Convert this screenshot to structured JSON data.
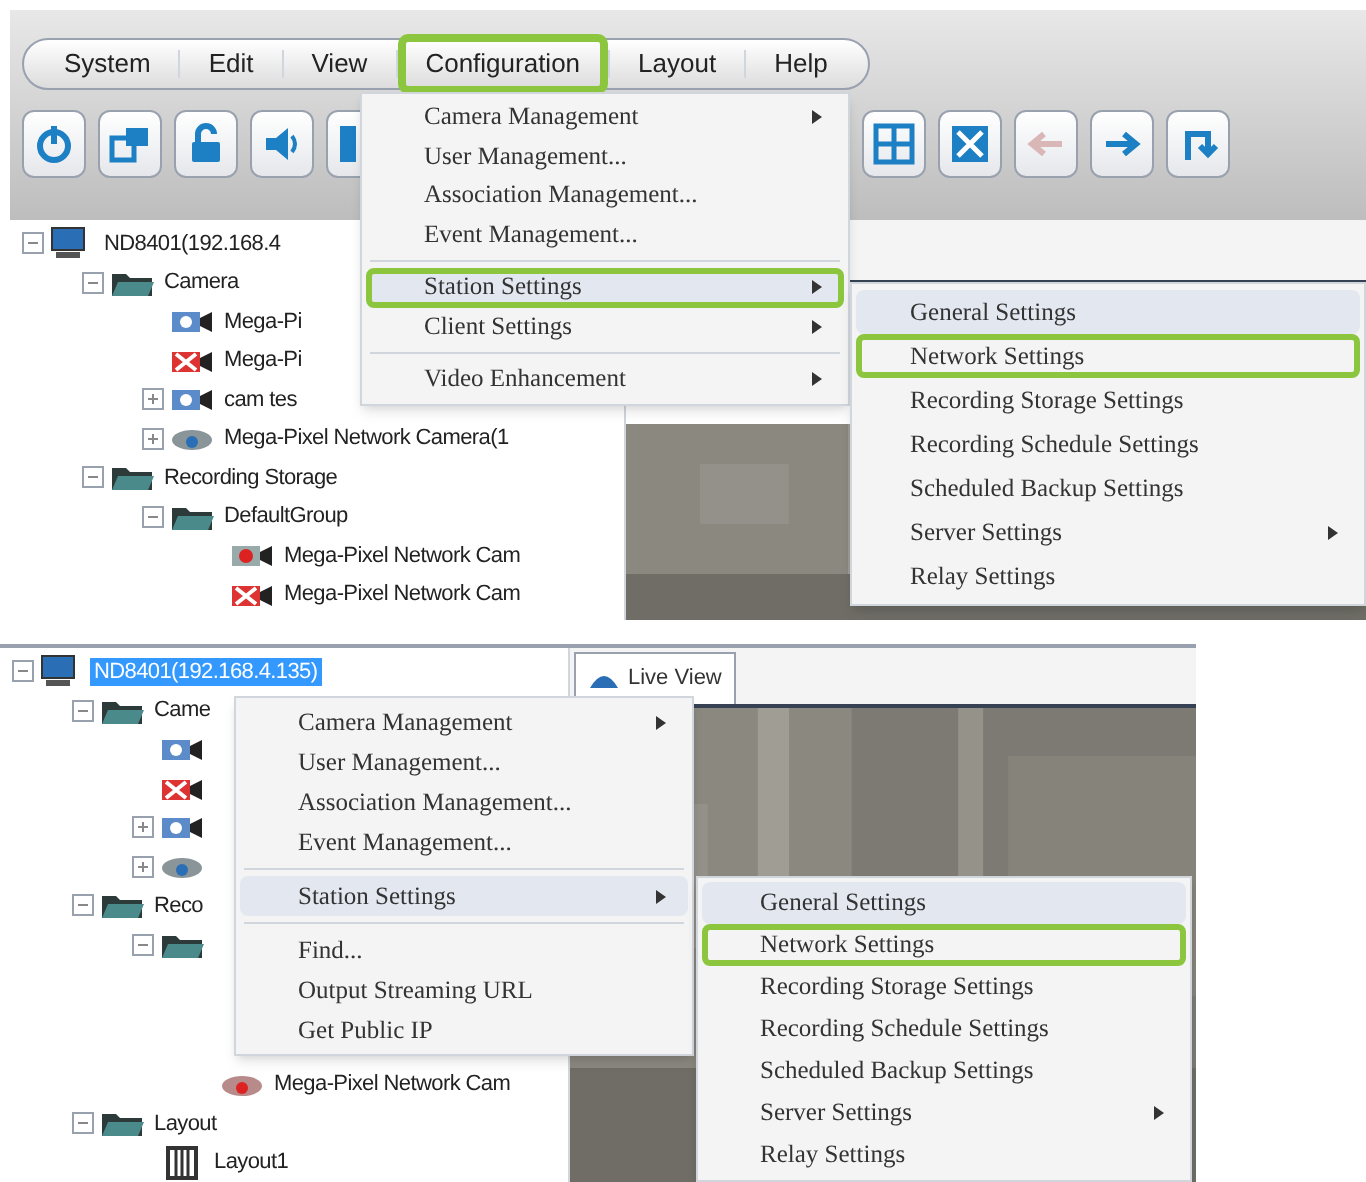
{
  "panels": [
    {
      "menubar": [
        {
          "label": "System",
          "callout": false
        },
        {
          "label": "Edit",
          "callout": false
        },
        {
          "label": "View",
          "callout": false
        },
        {
          "label": "Configuration",
          "callout": true
        },
        {
          "label": "Layout",
          "callout": false
        },
        {
          "label": "Help",
          "callout": false
        }
      ],
      "toolbar_left": [
        {
          "kind": "power"
        },
        {
          "kind": "windows"
        },
        {
          "kind": "lock"
        },
        {
          "kind": "speaker"
        },
        {
          "kind": "partial"
        }
      ],
      "toolbar_right": [
        {
          "kind": "grid"
        },
        {
          "kind": "fullscreen"
        },
        {
          "kind": "back",
          "disabled": true
        },
        {
          "kind": "forward",
          "disabled": false
        },
        {
          "kind": "return"
        }
      ],
      "tree": [
        {
          "label": "ND8401(192.168.4",
          "kind": "computer",
          "selected": false,
          "expanded": true,
          "children": [
            {
              "label": "Camera",
              "kind": "folder",
              "selected": false,
              "expanded": true,
              "children": [
                {
                  "label": "Mega-Pi",
                  "kind": "camera",
                  "selected": false
                },
                {
                  "label": "Mega-Pi",
                  "kind": "camera-off",
                  "selected": false
                },
                {
                  "label": "cam tes",
                  "kind": "camera",
                  "selected": false,
                  "expanded": false
                },
                {
                  "label": "Mega-Pixel Network Camera(1",
                  "kind": "dome",
                  "selected": false,
                  "expanded": false
                }
              ]
            },
            {
              "label": "Recording Storage",
              "kind": "folder",
              "selected": false,
              "expanded": true,
              "children": [
                {
                  "label": "DefaultGroup",
                  "kind": "folder",
                  "selected": false,
                  "expanded": true,
                  "children": [
                    {
                      "label": "Mega-Pixel Network Cam",
                      "kind": "camera-rec",
                      "selected": false
                    },
                    {
                      "label": "Mega-Pixel Network Cam",
                      "kind": "camera-off",
                      "selected": false
                    }
                  ]
                }
              ]
            }
          ]
        }
      ],
      "menu": [
        {
          "kind": "item",
          "label": "Camera Management",
          "submenu": true,
          "highlighted": false,
          "callout": false
        },
        {
          "kind": "item",
          "label": "User Management...",
          "submenu": false,
          "highlighted": false,
          "callout": false
        },
        {
          "kind": "item",
          "label": "Association Management...",
          "submenu": false,
          "highlighted": false,
          "callout": false
        },
        {
          "kind": "item",
          "label": "Event Management...",
          "submenu": false,
          "highlighted": false,
          "callout": false
        },
        {
          "kind": "separator"
        },
        {
          "kind": "item",
          "label": "Station Settings",
          "submenu": true,
          "highlighted": true,
          "callout": true
        },
        {
          "kind": "item",
          "label": "Client Settings",
          "submenu": true,
          "highlighted": false,
          "callout": false
        },
        {
          "kind": "separator"
        },
        {
          "kind": "item",
          "label": "Video Enhancement",
          "submenu": true,
          "highlighted": false,
          "callout": false
        }
      ],
      "submenu": [
        {
          "label": "General Settings",
          "submenu": false,
          "highlighted": true,
          "callout": false
        },
        {
          "label": "Network Settings",
          "submenu": false,
          "highlighted": false,
          "callout": true
        },
        {
          "label": "Recording Storage Settings",
          "submenu": false,
          "highlighted": false,
          "callout": false
        },
        {
          "label": "Recording Schedule Settings",
          "submenu": false,
          "highlighted": false,
          "callout": false
        },
        {
          "label": "Scheduled Backup Settings",
          "submenu": false,
          "highlighted": false,
          "callout": false
        },
        {
          "label": "Server Settings",
          "submenu": true,
          "highlighted": false,
          "callout": false
        },
        {
          "label": "Relay Settings",
          "submenu": false,
          "highlighted": false,
          "callout": false
        }
      ]
    },
    {
      "tab": {
        "label": "Live View",
        "selected": true
      },
      "tree": [
        {
          "label": "ND8401(192.168.4.135)",
          "kind": "computer",
          "selected": true,
          "expanded": true,
          "children": [
            {
              "label": "Came",
              "kind": "folder",
              "selected": false,
              "expanded": true,
              "children": [
                {
                  "kind": "camera"
                },
                {
                  "kind": "camera-off"
                },
                {
                  "kind": "camera",
                  "expanded": false
                },
                {
                  "kind": "dome",
                  "expanded": false
                }
              ]
            },
            {
              "label": "Reco",
              "kind": "folder",
              "selected": false,
              "expanded": true,
              "children": [
                {
                  "kind": "folder",
                  "expanded": true,
                  "children": [
                    {
                      "label": "Mega-Pixel Network Cam",
                      "kind": "dome-alert",
                      "selected": false
                    }
                  ]
                }
              ]
            },
            {
              "label": "Layout",
              "kind": "folder",
              "selected": false,
              "expanded": true,
              "children": [
                {
                  "label": "Layout1",
                  "kind": "layout",
                  "selected": false
                }
              ]
            }
          ]
        }
      ],
      "menu": [
        {
          "kind": "item",
          "label": "Camera Management",
          "submenu": true,
          "highlighted": false,
          "callout": false
        },
        {
          "kind": "item",
          "label": "User Management...",
          "submenu": false,
          "highlighted": false,
          "callout": false
        },
        {
          "kind": "item",
          "label": "Association Management...",
          "submenu": false,
          "highlighted": false,
          "callout": false
        },
        {
          "kind": "item",
          "label": "Event Management...",
          "submenu": false,
          "highlighted": false,
          "callout": false
        },
        {
          "kind": "separator"
        },
        {
          "kind": "item",
          "label": "Station Settings",
          "submenu": true,
          "highlighted": true,
          "callout": false
        },
        {
          "kind": "separator"
        },
        {
          "kind": "item",
          "label": "Find...",
          "submenu": false,
          "highlighted": false,
          "callout": false
        },
        {
          "kind": "item",
          "label": "Output Streaming URL",
          "submenu": false,
          "highlighted": false,
          "callout": false
        },
        {
          "kind": "item",
          "label": "Get Public IP",
          "submenu": false,
          "highlighted": false,
          "callout": false
        }
      ],
      "submenu": [
        {
          "label": "General Settings",
          "submenu": false,
          "highlighted": true,
          "callout": false
        },
        {
          "label": "Network Settings",
          "submenu": false,
          "highlighted": false,
          "callout": true
        },
        {
          "label": "Recording Storage Settings",
          "submenu": false,
          "highlighted": false,
          "callout": false
        },
        {
          "label": "Recording Schedule Settings",
          "submenu": false,
          "highlighted": false,
          "callout": false
        },
        {
          "label": "Scheduled Backup Settings",
          "submenu": false,
          "highlighted": false,
          "callout": false
        },
        {
          "label": "Server Settings",
          "submenu": true,
          "highlighted": false,
          "callout": false
        },
        {
          "label": "Relay Settings",
          "submenu": false,
          "highlighted": false,
          "callout": false
        }
      ]
    }
  ]
}
